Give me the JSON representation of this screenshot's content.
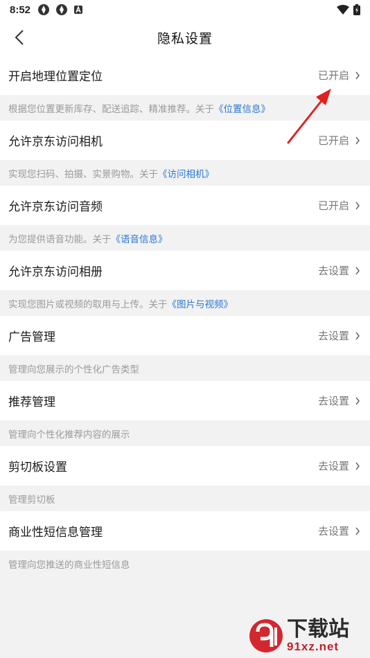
{
  "status_bar": {
    "time": "8:52"
  },
  "header": {
    "title": "隐私设置"
  },
  "settings": [
    {
      "label": "开启地理位置定位",
      "status": "已开启",
      "desc_prefix": "根据您位置更新库存、配送追踪、精准推荐。关于",
      "desc_link": "《位置信息》"
    },
    {
      "label": "允许京东访问相机",
      "status": "已开启",
      "desc_prefix": "实现您扫码、拍摄、实景购物。关于",
      "desc_link": "《访问相机》"
    },
    {
      "label": "允许京东访问音频",
      "status": "已开启",
      "desc_prefix": "为您提供语音功能。关于",
      "desc_link": "《语音信息》"
    },
    {
      "label": "允许京东访问相册",
      "status": "去设置",
      "desc_prefix": "实现您图片或视频的取用与上传。关于",
      "desc_link": "《图片与视频》"
    },
    {
      "label": "广告管理",
      "status": "去设置",
      "desc_prefix": "管理向您展示的个性化广告类型",
      "desc_link": ""
    },
    {
      "label": "推荐管理",
      "status": "去设置",
      "desc_prefix": "管理向个性化推荐内容的展示",
      "desc_link": ""
    },
    {
      "label": "剪切板设置",
      "status": "去设置",
      "desc_prefix": "管理剪切板",
      "desc_link": ""
    },
    {
      "label": "商业性短信息管理",
      "status": "去设置",
      "desc_prefix": "管理向您推送的商业性短信息",
      "desc_link": ""
    }
  ],
  "watermark": {
    "text_cn": "下载站",
    "text_en": "91xz.net"
  },
  "colors": {
    "link": "#2a78d6",
    "annotation_arrow": "#e02020",
    "background": "#f2f2f2"
  }
}
